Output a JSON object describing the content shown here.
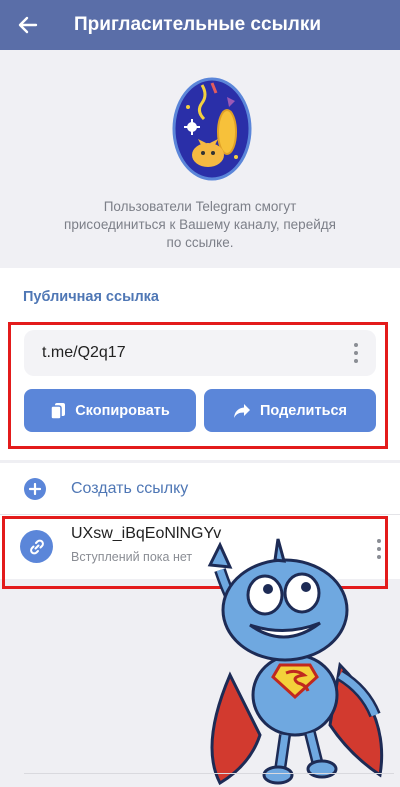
{
  "appbar": {
    "title": "Пригласительные ссылки",
    "back_icon": "arrow-left-icon",
    "color": "#5a6ea8"
  },
  "intro": {
    "line1": "Пользователи Telegram смогут",
    "line2": "присоединиться к Вашему каналу, перейдя",
    "line3": "по ссылке."
  },
  "public_link": {
    "section_title": "Публичная ссылка",
    "link": "t.me/Q2q17",
    "copy_label": "Скопировать",
    "share_label": "Поделиться"
  },
  "links": {
    "create_label": "Создать ссылку",
    "items": [
      {
        "name": "UXsw_iBqEoNlNGYv",
        "status": "Вступлений пока нет"
      }
    ]
  },
  "colors": {
    "accent": "#5b86d9",
    "link_text": "#4f77b5",
    "highlight": "#e31b1b"
  }
}
